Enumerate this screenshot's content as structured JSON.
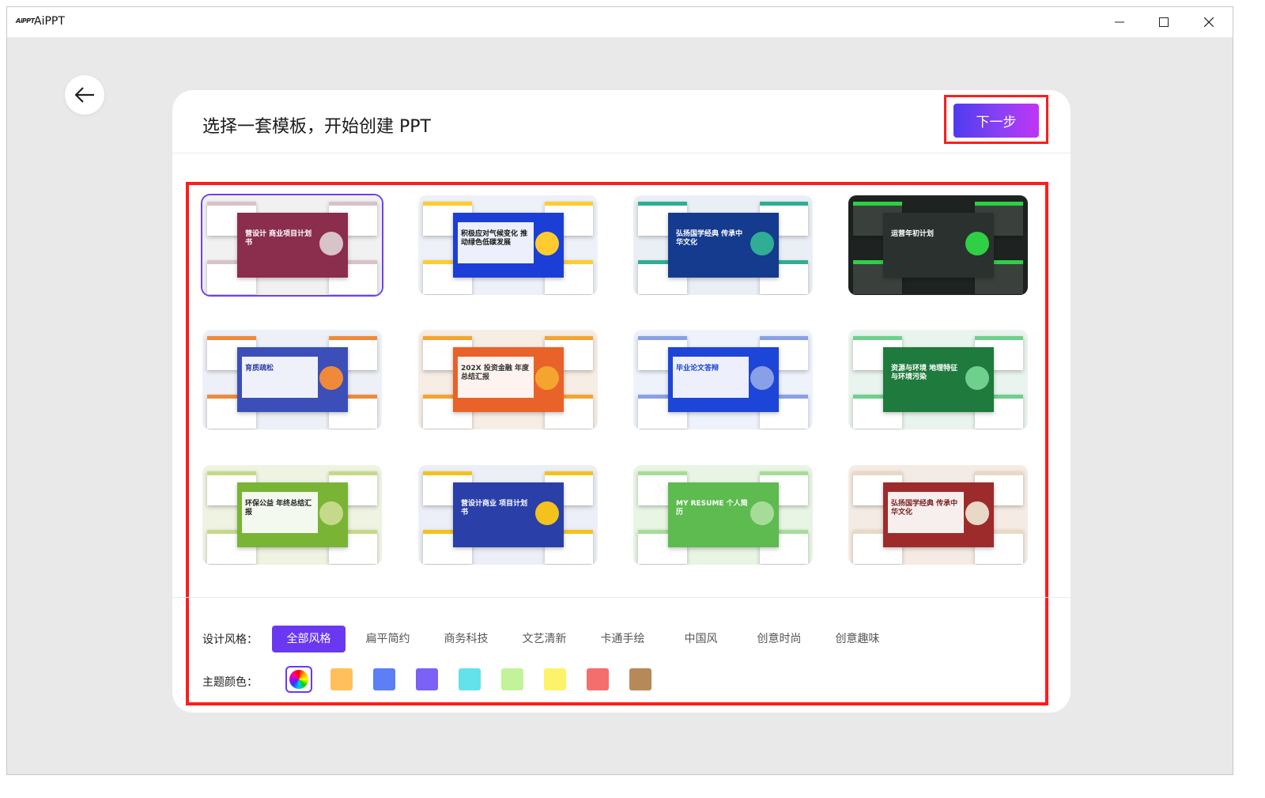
{
  "window": {
    "logo_text": "AiPPT",
    "title": "AiPPT"
  },
  "header": {
    "title": "选择一套模板，开始创建 PPT",
    "next_label": "下一步"
  },
  "templates": [
    {
      "title": "营设计 商业项目计划书",
      "bg": "#f1f1f1",
      "slide": "#8b2d4c",
      "ink": "#ffffff",
      "accent": "#d8c3c8",
      "selected": true
    },
    {
      "title": "积极应对气候变化 推动绿色低碳发展",
      "bg": "#eef1f8",
      "slide": "#1b3fd6",
      "ink": "#1a1a1a",
      "accent": "#ffcb2e",
      "selected": false
    },
    {
      "title": "弘扬国学经典 传承中华文化",
      "bg": "#eaeff6",
      "slide": "#143b8e",
      "ink": "#ffffff",
      "accent": "#2fae95",
      "selected": false
    },
    {
      "title": "运营年初计划",
      "bg": "#1e2321",
      "slide": "#2b312e",
      "ink": "#ffffff",
      "accent": "#2fcf46",
      "selected": false
    },
    {
      "title": "育质疏松",
      "bg": "#eef0f7",
      "slide": "#3c4fb8",
      "ink": "#2f3ba8",
      "accent": "#f08a3a",
      "selected": false
    },
    {
      "title": "202X 投资金融 年度总结汇报",
      "bg": "#f6ede4",
      "slide": "#e9622a",
      "ink": "#333333",
      "accent": "#f3a530",
      "selected": false
    },
    {
      "title": "毕业论文答辩",
      "bg": "#eef2fb",
      "slide": "#1d45d8",
      "ink": "#1d45d8",
      "accent": "#8aa0e6",
      "selected": false
    },
    {
      "title": "资源与环境 地理特征与环境污染",
      "bg": "#eaf4ee",
      "slide": "#1e7a3d",
      "ink": "#ffffff",
      "accent": "#6fcf8d",
      "selected": false
    },
    {
      "title": "环保公益 年终总结汇报",
      "bg": "#eef3e2",
      "slide": "#79b434",
      "ink": "#222222",
      "accent": "#c5d98a",
      "selected": false
    },
    {
      "title": "营设计商业 项目计划书",
      "bg": "#eceff7",
      "slide": "#2a3fa8",
      "ink": "#ffffff",
      "accent": "#f3c21c",
      "selected": false
    },
    {
      "title": "MY RESUME 个人简历",
      "bg": "#e8f4e4",
      "slide": "#5dbb4f",
      "ink": "#ffffff",
      "accent": "#a7dc98",
      "selected": false
    },
    {
      "title": "弘扬国学经典 传承中华文化",
      "bg": "#f4ece4",
      "slide": "#9e2b2b",
      "ink": "#7a2020",
      "accent": "#e8d8c6",
      "selected": false
    }
  ],
  "filters": {
    "style_label": "设计风格：",
    "styles": [
      {
        "label": "全部风格",
        "active": true
      },
      {
        "label": "扁平简约",
        "active": false
      },
      {
        "label": "商务科技",
        "active": false
      },
      {
        "label": "文艺清新",
        "active": false
      },
      {
        "label": "卡通手绘",
        "active": false
      },
      {
        "label": "中国风",
        "active": false
      },
      {
        "label": "创意时尚",
        "active": false
      },
      {
        "label": "创意趣味",
        "active": false
      }
    ],
    "color_label": "主题颜色：",
    "colors": [
      "#ffc05c",
      "#5c7ff5",
      "#7c61f6",
      "#64e2ec",
      "#c2f39a",
      "#fdf36a",
      "#f56e6e",
      "#b88958"
    ]
  }
}
